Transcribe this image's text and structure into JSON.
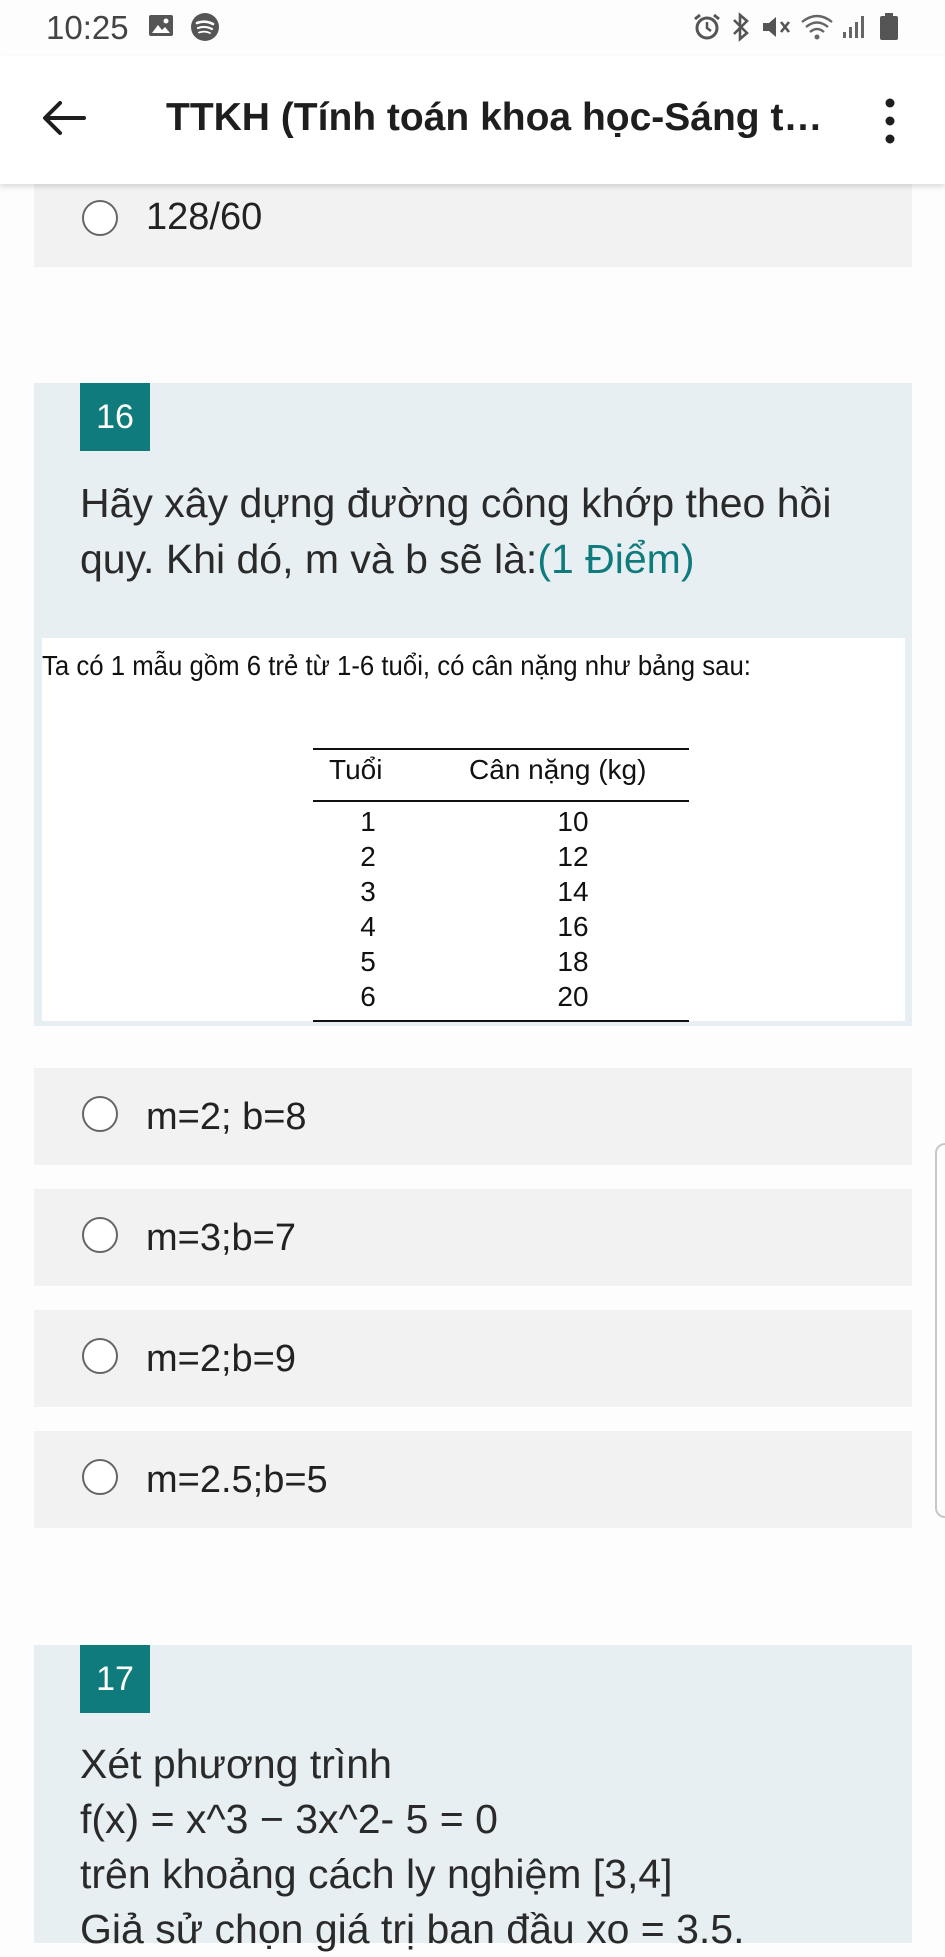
{
  "status_bar": {
    "time": "10:25",
    "left_icons": [
      "image-icon",
      "spotify-icon"
    ],
    "right_icons": [
      "alarm-icon",
      "bluetooth-icon",
      "mute-icon",
      "wifi-icon",
      "signal-icon",
      "battery-icon"
    ]
  },
  "app_bar": {
    "title": "TTKH (Tính toán khoa học-Sáng th...",
    "back_icon": "arrow-left-icon",
    "menu_icon": "more-vertical-icon"
  },
  "prev_option": {
    "label": "128/60"
  },
  "question_16": {
    "number": "16",
    "text": "Hãy xây dựng đường công khớp theo hồi quy. Khi dó, m và b sẽ là:",
    "points": "(1 Điểm)",
    "image": {
      "caption": "Ta có 1 mẫu gồm 6 trẻ từ 1-6 tuổi, có cân nặng như bảng sau:",
      "table": {
        "headers": [
          "Tuổi",
          "Cân nặng (kg)"
        ],
        "rows": [
          [
            "1",
            "10"
          ],
          [
            "2",
            "12"
          ],
          [
            "3",
            "14"
          ],
          [
            "4",
            "16"
          ],
          [
            "5",
            "18"
          ],
          [
            "6",
            "20"
          ]
        ]
      }
    },
    "options": [
      "m=2; b=8",
      "m=3;b=7",
      "m=2;b=9",
      "m=2.5;b=5"
    ]
  },
  "question_17": {
    "number": "17",
    "lines": [
      "Xét phương trình",
      "f(x) = x^3 − 3x^2- 5 = 0",
      "trên khoảng cách ly nghiệm [3,4]",
      "Giả sử chọn giá trị ban đầu xo = 3.5."
    ]
  },
  "colors": {
    "accent": "#0f7b7d",
    "question_bg": "#e8eff2",
    "option_bg": "#f2f2f2"
  }
}
